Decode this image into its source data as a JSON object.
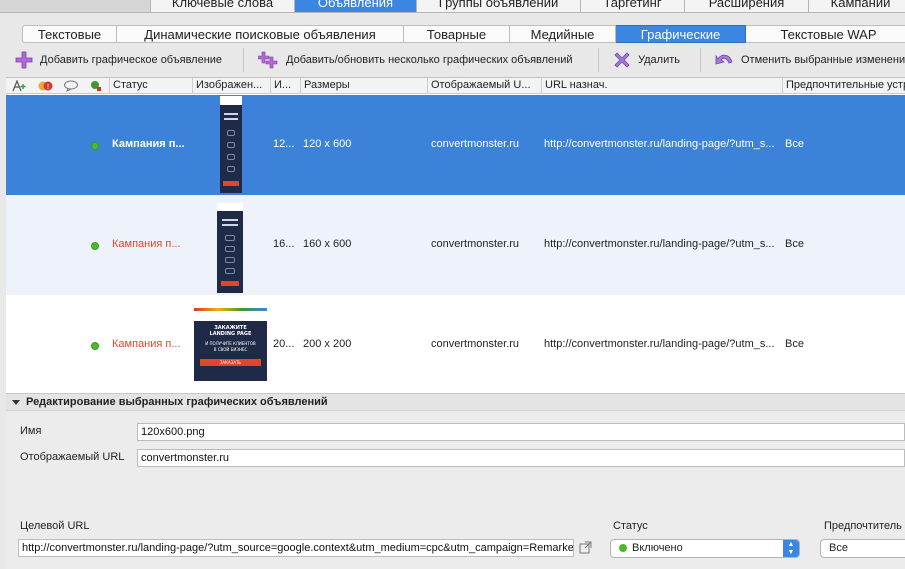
{
  "top_tabs": [
    "Ключевые слова",
    "Объявления",
    "Группы объявлений",
    "Таргетинг",
    "Расширения",
    "Кампании"
  ],
  "sub_tabs": [
    "Текстовые",
    "Динамические поисковые объявления",
    "Товарные",
    "Медийные",
    "Графические",
    "Текстовые WAP"
  ],
  "toolbar": {
    "add_label": "Добавить графическое объявление",
    "add_multi_label": "Добавить/обновить несколько графических объявлений",
    "delete_label": "Удалить",
    "revert_label": "Отменить выбранные изменения"
  },
  "table": {
    "columns": [
      "Статус",
      "Изображен...",
      "И...",
      "Размеры",
      "Отображаемый U...",
      "URL назнач.",
      "Предпочтительные устройства"
    ],
    "rows": [
      {
        "status": "Кампания п...",
        "id": "12...",
        "size": "120 x 600",
        "display_url": "convertmonster.ru",
        "dest_url": "http://convertmonster.ru/landing-page/?utm_s...",
        "device": "Все"
      },
      {
        "status": "Кампания п...",
        "id": "16...",
        "size": "160 x 600",
        "display_url": "convertmonster.ru",
        "dest_url": "http://convertmonster.ru/landing-page/?utm_s...",
        "device": "Все"
      },
      {
        "status": "Кампания п...",
        "id": "20...",
        "size": "200 x 200",
        "display_url": "convertmonster.ru",
        "dest_url": "http://convertmonster.ru/landing-page/?utm_s...",
        "device": "Все"
      }
    ],
    "banner_text": [
      "ЗАКАЖИТЕ",
      "LANDING PAGE",
      "И ПОЛУЧИТЕ КЛИЕНТОВ",
      "В СВОЙ БИЗНЕС",
      "ЗАКАЗАТЬ"
    ]
  },
  "edit": {
    "header": "Редактирование выбранных графических объявлений",
    "name_label": "Имя",
    "name_value": "120x600.png",
    "display_url_label": "Отображаемый URL",
    "display_url_value": "convertmonster.ru",
    "dest_url_label": "Целевой URL",
    "dest_url_value": "http://convertmonster.ru/landing-page/?utm_source=google.context&utm_medium=cpc&utm_campaign=Remarke",
    "status_label": "Статус",
    "status_value": "Включено",
    "device_label": "Предпочтитель",
    "device_value": "Все"
  },
  "colors": {
    "accent": "#3b86e0",
    "selected_row": "#3d82d9",
    "status_ok": "#4cb82c",
    "campaign_paused": "#e2462a"
  }
}
